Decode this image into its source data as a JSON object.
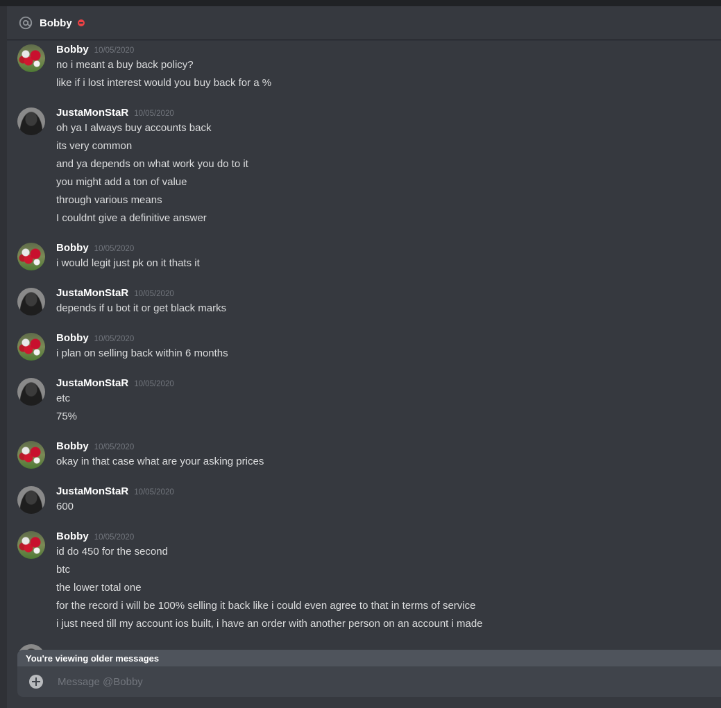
{
  "header": {
    "title": "Bobby",
    "status": "do-not-disturb"
  },
  "colors": {
    "background": "#36393f",
    "username": "#ffffff",
    "message_text": "#dcddde",
    "timestamp": "#72767d",
    "dnd_status": "#ed4245",
    "banner": "#4f545c",
    "composer": "#40444b"
  },
  "messages": [
    {
      "author": "Bobby",
      "timestamp": "10/05/2020",
      "lines": [
        "no i meant a buy back policy?",
        "like if i lost interest would you buy back for a %"
      ]
    },
    {
      "author": "JustaMonStaR",
      "timestamp": "10/05/2020",
      "lines": [
        "oh ya I always buy accounts back",
        "its very common",
        "and ya depends on what work you do to it",
        "you might add a ton of value",
        "through various means",
        "I couldnt give a definitive answer"
      ]
    },
    {
      "author": "Bobby",
      "timestamp": "10/05/2020",
      "lines": [
        "i would legit just pk on it thats it"
      ]
    },
    {
      "author": "JustaMonStaR",
      "timestamp": "10/05/2020",
      "lines": [
        "depends if u bot it or get black marks"
      ]
    },
    {
      "author": "Bobby",
      "timestamp": "10/05/2020",
      "lines": [
        "i plan on selling back within 6 months"
      ]
    },
    {
      "author": "JustaMonStaR",
      "timestamp": "10/05/2020",
      "lines": [
        "etc",
        "75%"
      ]
    },
    {
      "author": "Bobby",
      "timestamp": "10/05/2020",
      "lines": [
        "okay in that case what are your asking prices"
      ]
    },
    {
      "author": "JustaMonStaR",
      "timestamp": "10/05/2020",
      "lines": [
        "600"
      ]
    },
    {
      "author": "Bobby",
      "timestamp": "10/05/2020",
      "lines": [
        "id do 450 for the second",
        "btc",
        "the lower total one",
        "for the record i will be 100% selling it back like i could even agree to that in terms of service",
        "i just need till my account ios built, i have an order with another person on an account i made"
      ]
    }
  ],
  "older_banner": "You're viewing older messages",
  "composer": {
    "placeholder": "Message @Bobby"
  }
}
